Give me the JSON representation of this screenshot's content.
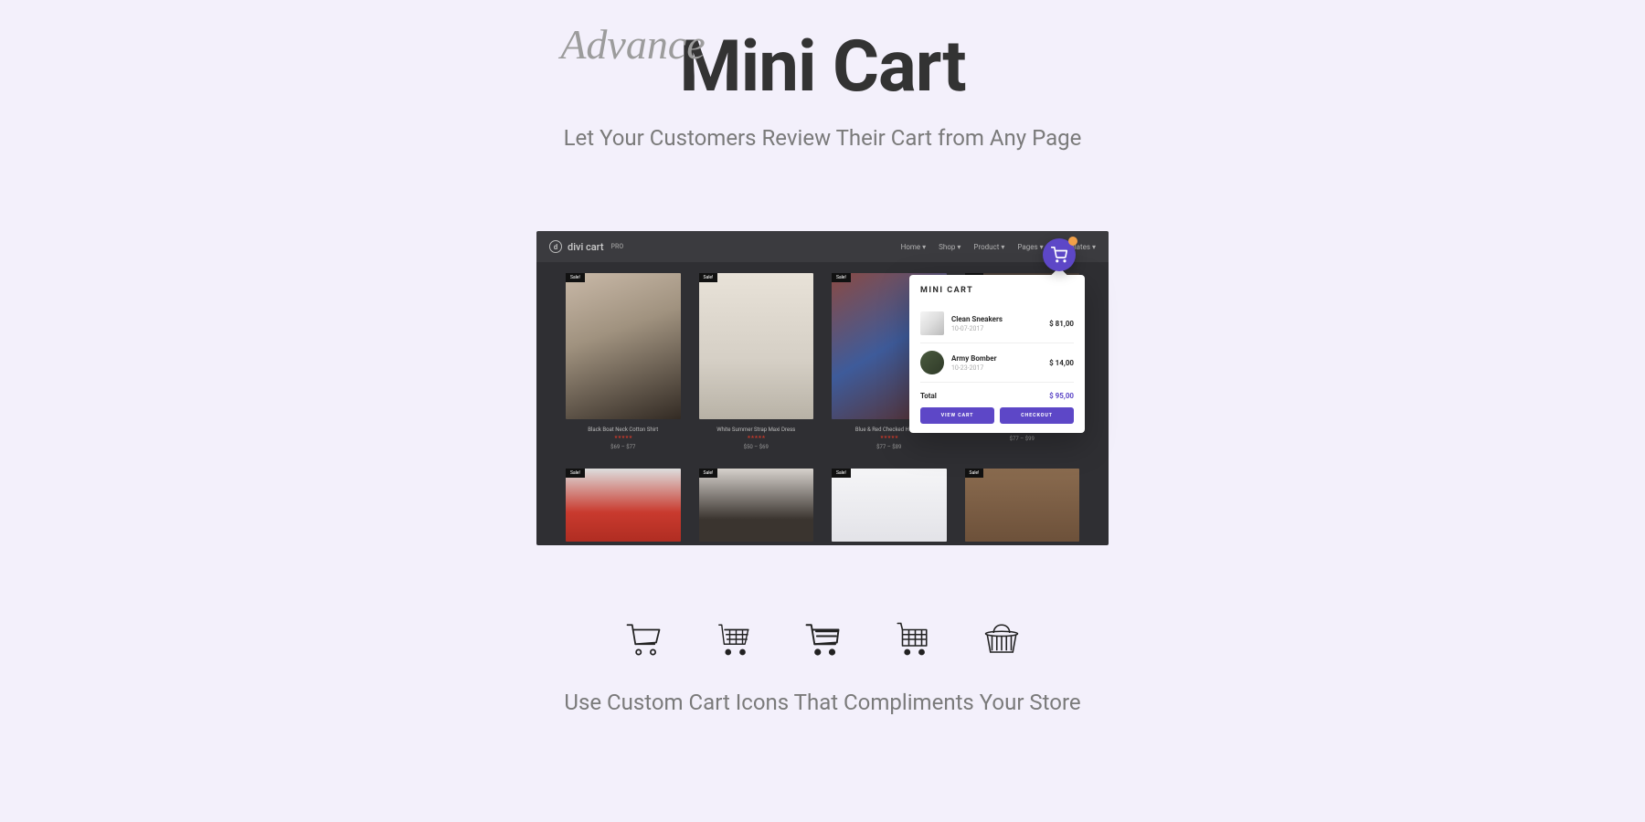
{
  "hero": {
    "script": "Advance",
    "title": "Mini Cart",
    "subtitle": "Let Your Customers Review Their Cart from Any Page"
  },
  "mockup": {
    "logo_text": "divi cart",
    "logo_sup": "PRO",
    "nav": [
      "Home ▾",
      "Shop ▾",
      "Product ▾",
      "Pages ▾",
      "Templates ▾"
    ],
    "sale_label": "Sale!",
    "products": [
      {
        "title": "Black Boat Neck Cotton Shirt",
        "price": "$69 – $77"
      },
      {
        "title": "White Summer Strap Maxi Dress",
        "price": "$50 – $69"
      },
      {
        "title": "Blue & Red Checked Hoodie",
        "price": "$77 – $89"
      },
      {
        "title": "",
        "price": "$77 – $99"
      }
    ]
  },
  "mini_cart": {
    "title": "MINI CART",
    "items": [
      {
        "name": "Clean Sneakers",
        "date": "10-07-2017",
        "price": "$ 81,00"
      },
      {
        "name": "Army Bomber",
        "date": "10-23-2017",
        "price": "$ 14,00"
      }
    ],
    "total_label": "Total",
    "total_value": "$ 95,00",
    "view_cart_label": "VIEW CART",
    "checkout_label": "CHECKOUT"
  },
  "icons_section": {
    "caption": "Use Custom Cart Icons That Compliments Your Store"
  }
}
